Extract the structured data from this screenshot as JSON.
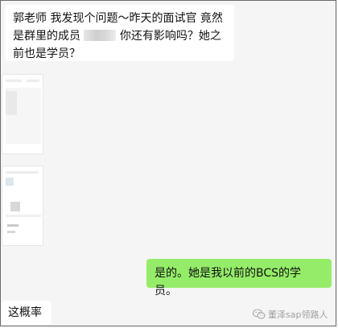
{
  "messages": [
    {
      "side": "incoming",
      "text_before": "郭老师 我发现个问题～昨天的面试官  竟然是群里的成员",
      "text_after": "你还有影响吗？她之前也是学员？"
    },
    {
      "side": "incoming",
      "type": "image"
    },
    {
      "side": "incoming",
      "type": "image"
    },
    {
      "side": "outgoing",
      "text": "是的。她是我以前的BCS的学员。"
    },
    {
      "side": "incoming",
      "text": "这概率"
    }
  ],
  "watermark": {
    "text": "董泽sap领路人",
    "icon": "wechat-icon"
  },
  "colors": {
    "background": "#f5f5f5",
    "incoming_bubble": "#ffffff",
    "outgoing_bubble": "#95ec69"
  }
}
